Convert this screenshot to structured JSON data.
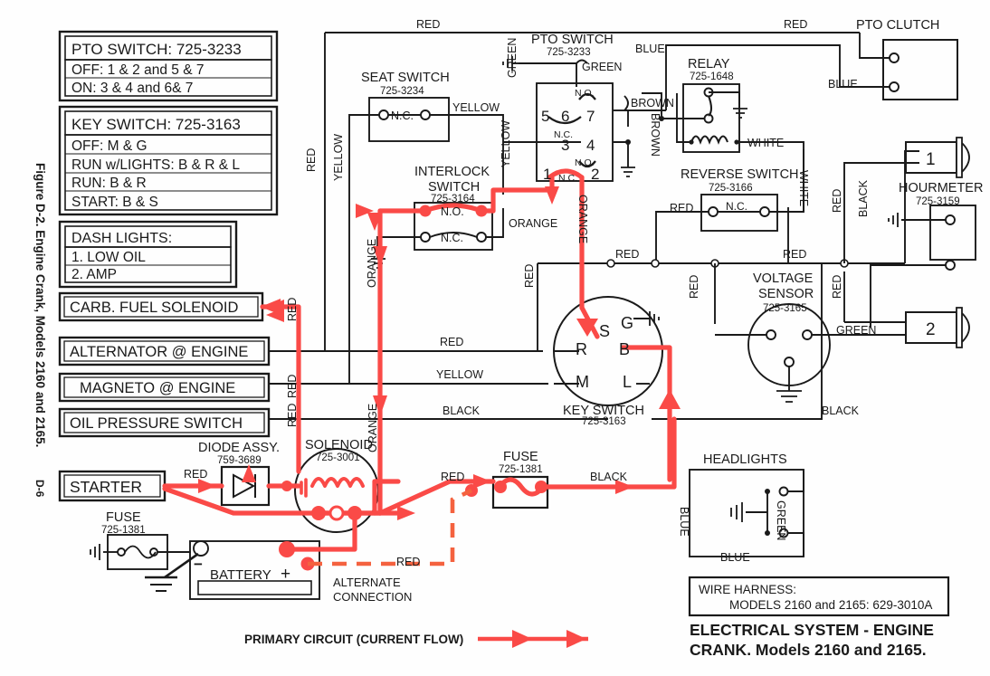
{
  "figure": {
    "caption": "Figure D-2. Engine Crank, Models 2160 and 2165.",
    "page_number": "D-6"
  },
  "legend_boxes": [
    {
      "name": "pto-switch-legend",
      "title": "PTO SWITCH: 725-3233",
      "rows": [
        "OFF: 1 & 2 and 5 & 7",
        "ON:   3 & 4 and 6& 7"
      ]
    },
    {
      "name": "key-switch-legend",
      "title": "KEY SWITCH: 725-3163",
      "rows": [
        "OFF: M & G",
        "RUN w/LIGHTS:  B & R & L",
        "RUN: B & R",
        "START: B & S"
      ]
    },
    {
      "name": "dash-lights-legend",
      "title": "DASH LIGHTS:",
      "rows": [
        "1. LOW OIL",
        "2. AMP"
      ]
    }
  ],
  "component_boxes": [
    {
      "name": "carb-fuel-solenoid",
      "label": "CARB. FUEL SOLENOID"
    },
    {
      "name": "alternator-at-engine",
      "label": "ALTERNATOR @ ENGINE"
    },
    {
      "name": "magneto-at-engine",
      "label": "MAGNETO @ ENGINE"
    },
    {
      "name": "oil-pressure-switch",
      "label": "OIL PRESSURE SWITCH"
    },
    {
      "name": "starter",
      "label": "STARTER"
    }
  ],
  "components": {
    "seat_switch": {
      "title": "SEAT SWITCH",
      "part": "725-3234",
      "contact": "N.C."
    },
    "interlock_switch": {
      "title": "INTERLOCK",
      "title2": "SWITCH",
      "part": "725-3164",
      "contact_no": "N.O.",
      "contact_nc": "N.C."
    },
    "pto_switch": {
      "title": "PTO SWITCH",
      "part": "725-3233",
      "terminals": [
        "5",
        "6",
        "7",
        "3",
        "4",
        "1",
        "2"
      ],
      "labels": [
        "N.O.",
        "N.C.",
        "N.O.",
        "N.C."
      ]
    },
    "relay": {
      "title": "RELAY",
      "part": "725-1648"
    },
    "reverse_switch": {
      "title": "REVERSE SWITCH",
      "part": "725-3166",
      "contact": "N.C."
    },
    "pto_clutch": {
      "title": "PTO  CLUTCH"
    },
    "hourmeter": {
      "title": "HOURMETER",
      "part": "725-3159"
    },
    "voltage_sensor": {
      "title": "VOLTAGE",
      "title2": "SENSOR",
      "part": "725-3165"
    },
    "key_switch": {
      "title": "KEY SWITCH",
      "part": "725-3163",
      "terminals": [
        "G",
        "S",
        "B",
        "R",
        "M",
        "L"
      ]
    },
    "diode_assy": {
      "title": "DIODE ASSY.",
      "part": "759-3689"
    },
    "solenoid": {
      "title": "SOLENOID",
      "part": "725-3001"
    },
    "fuse_main": {
      "title": "FUSE",
      "part": "725-1381"
    },
    "fuse_left": {
      "title": "FUSE",
      "part": "725-1381"
    },
    "battery": {
      "label": "BATTERY",
      "minus": "−",
      "plus": "+"
    },
    "headlights": {
      "title": "HEADLIGHTS"
    },
    "lamp1": {
      "label": "1"
    },
    "lamp2": {
      "label": "2"
    }
  },
  "wire_labels": {
    "red": "RED",
    "blue": "BLUE",
    "green": "GREEN",
    "brown": "BROWN",
    "white": "WHITE",
    "yellow": "YELLOW",
    "orange": "ORANGE",
    "black": "BLACK"
  },
  "annotations": {
    "alternate_connection_color": "RED",
    "alternate_connection_line1": "ALTERNATE",
    "alternate_connection_line2": "CONNECTION",
    "primary_circuit": "PRIMARY CIRCUIT (CURRENT FLOW)"
  },
  "wire_harness": {
    "title": "WIRE HARNESS:",
    "detail": "MODELS 2160 and 2165: 629-3010A"
  },
  "title_block": {
    "line1": "ELECTRICAL SYSTEM - ENGINE",
    "line2": "CRANK. Models 2160 and 2165."
  },
  "colors": {
    "ink": "#1a1a1a",
    "primary_circuit": "#fa4a47",
    "background": "#ffffff"
  }
}
